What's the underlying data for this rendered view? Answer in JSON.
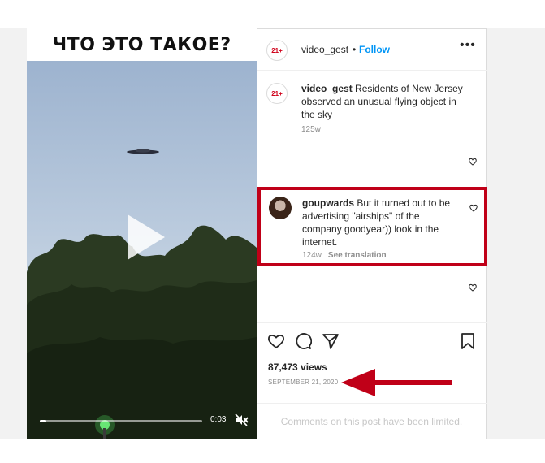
{
  "video": {
    "overlay_title": "ЧТО ЭТО ТАКОЕ?",
    "time": "0:03"
  },
  "header": {
    "avatar_text": "21+",
    "username": "video_gest",
    "separator": "•",
    "follow_label": "Follow",
    "more_label": "•••"
  },
  "caption": {
    "avatar_text": "21+",
    "username": "video_gest",
    "text": "Residents of New Jersey observed an unusual flying object in the sky",
    "age": "125w"
  },
  "comment": {
    "username": "goupwards",
    "text": "But it turned out to be advertising \"airships\" of the company goodyear)) look in the internet.",
    "age": "124w",
    "see_translation": "See translation"
  },
  "stats": {
    "views": "87,473 views",
    "date": "SEPTEMBER 21, 2020"
  },
  "footer": {
    "limited_text": "Comments on this post have been limited."
  },
  "colors": {
    "highlight": "#c00018",
    "follow": "#0095f6",
    "badge": "#d0021b"
  },
  "icons": [
    "like-icon",
    "comment-icon",
    "share-icon",
    "save-icon",
    "play-icon",
    "mute-icon",
    "more-icon"
  ]
}
